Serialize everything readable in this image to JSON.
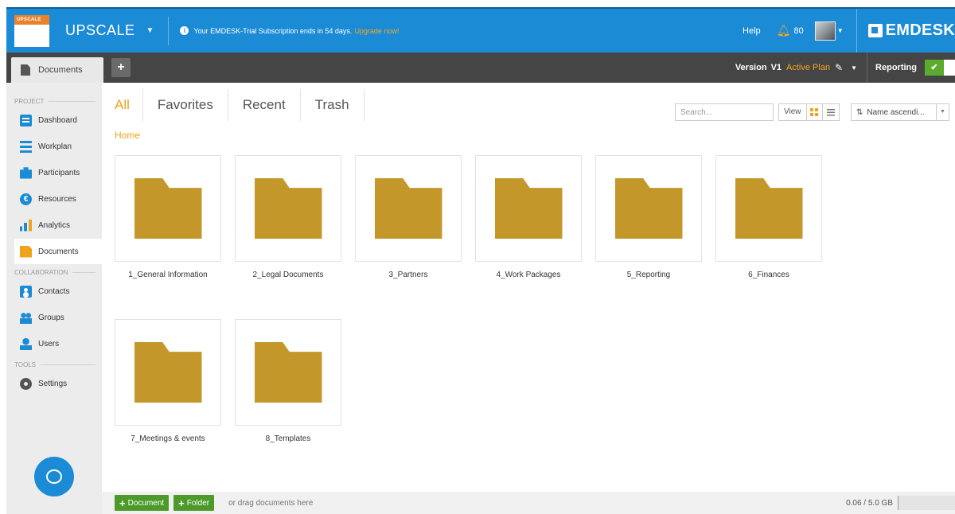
{
  "header": {
    "logo_text": "UPSCALE",
    "project_name": "UPSCALE",
    "trial_message": "Your EMDESK-Trial Subscription ends in 54 days.",
    "upgrade_link": "Upgrade now!",
    "help_label": "Help",
    "notification_count": "80",
    "brand_name": "EMDESK"
  },
  "subbar": {
    "documents_tab": "Documents",
    "add_tab_label": "+",
    "version_label": "Version",
    "version_value": "V1",
    "active_plan": "Active Plan",
    "reporting_label": "Reporting"
  },
  "sidebar": {
    "sections": {
      "project": "PROJECT",
      "collaboration": "COLLABORATION",
      "tools": "TOOLS"
    },
    "items": {
      "dashboard": "Dashboard",
      "workplan": "Workplan",
      "participants": "Participants",
      "resources": "Resources",
      "analytics": "Analytics",
      "documents": "Documents",
      "contacts": "Contacts",
      "groups": "Groups",
      "users": "Users",
      "settings": "Settings"
    },
    "resources_glyph": "€"
  },
  "main": {
    "tabs": {
      "all": "All",
      "favorites": "Favorites",
      "recent": "Recent",
      "trash": "Trash"
    },
    "search_placeholder": "Search...",
    "view_label": "View",
    "sort_value": "Name ascendi...",
    "breadcrumb": "Home",
    "folders": [
      "1_General Information",
      "2_Legal Documents",
      "3_Partners",
      "4_Work Packages",
      "5_Reporting",
      "6_Finances",
      "7_Meetings & events",
      "8_Templates"
    ]
  },
  "footer": {
    "add_document": "Document",
    "add_folder": "Folder",
    "drag_hint": "or drag documents here",
    "storage": "0.06 / 5.0 GB"
  },
  "colors": {
    "header_blue": "#1b8bd6",
    "accent_orange": "#f0a21b",
    "folder_gold": "#c4972b",
    "button_green": "#4c9a2a",
    "dark_bar": "#454545"
  }
}
